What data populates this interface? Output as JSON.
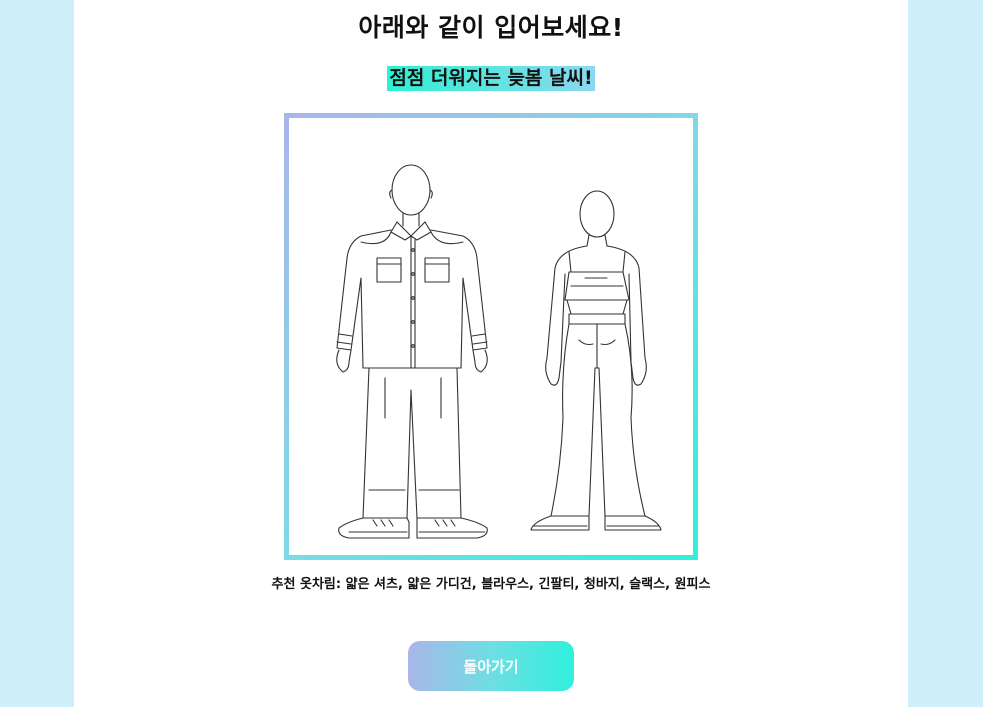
{
  "title": "아래와 같이 입어보세요!",
  "subtitle": "점점 더워지는 늦봄 날씨!",
  "image": {
    "description_icon": "outfit-illustration"
  },
  "recommend": "추천 옷차림: 얇은 셔츠, 얇은 가디건, 블라우스, 긴팔티, 청바지, 슬랙스, 원피스",
  "back_button": "돌아가기",
  "colors": {
    "background": "#cff0fb",
    "accent_start": "#a9b6e8",
    "accent_end": "#2ff0dc",
    "highlight": "#2ef0d2"
  }
}
